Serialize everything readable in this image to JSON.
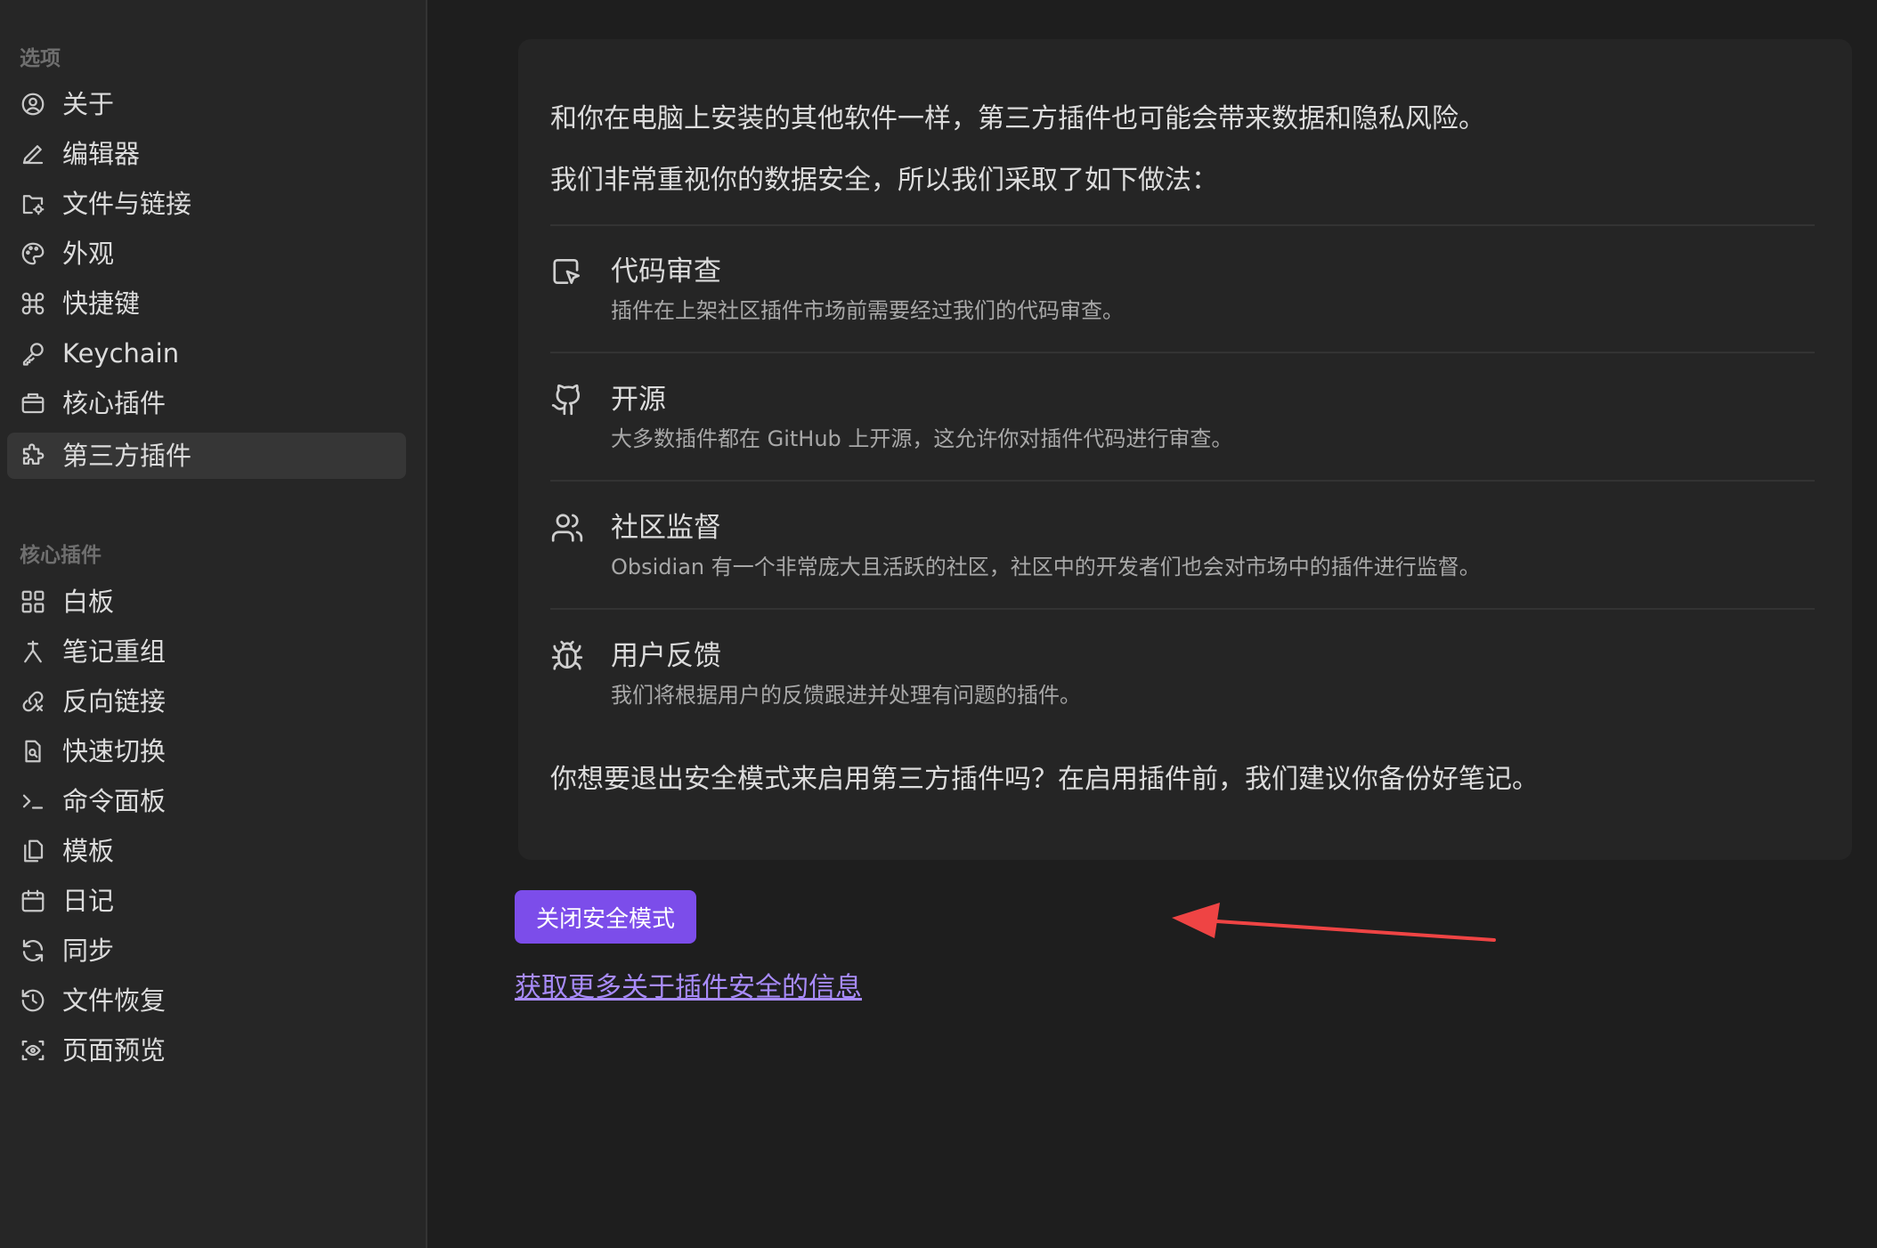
{
  "sidebar": {
    "options_title": "选项",
    "options": [
      {
        "label": "关于",
        "icon": "user-circle-icon"
      },
      {
        "label": "编辑器",
        "icon": "pencil-icon"
      },
      {
        "label": "文件与链接",
        "icon": "folder-cog-icon"
      },
      {
        "label": "外观",
        "icon": "palette-icon"
      },
      {
        "label": "快捷键",
        "icon": "command-icon"
      },
      {
        "label": "Keychain",
        "icon": "key-icon"
      },
      {
        "label": "核心插件",
        "icon": "briefcase-icon"
      },
      {
        "label": "第三方插件",
        "icon": "puzzle-icon",
        "active": true
      }
    ],
    "core_title": "核心插件",
    "core": [
      {
        "label": "白板",
        "icon": "layout-dashboard-icon"
      },
      {
        "label": "笔记重组",
        "icon": "merge-icon"
      },
      {
        "label": "反向链接",
        "icon": "backlink-icon"
      },
      {
        "label": "快速切换",
        "icon": "file-search-icon"
      },
      {
        "label": "命令面板",
        "icon": "terminal-icon"
      },
      {
        "label": "模板",
        "icon": "files-icon"
      },
      {
        "label": "日记",
        "icon": "calendar-icon"
      },
      {
        "label": "同步",
        "icon": "refresh-icon"
      },
      {
        "label": "文件恢复",
        "icon": "history-icon"
      },
      {
        "label": "页面预览",
        "icon": "scan-eye-icon"
      }
    ]
  },
  "main": {
    "intro_1": "和你在电脑上安装的其他软件一样，第三方插件也可能会带来数据和隐私风险。",
    "intro_2": "我们非常重视你的数据安全，所以我们采取了如下做法：",
    "features": [
      {
        "icon": "review-icon",
        "title": "代码审查",
        "desc": "插件在上架社区插件市场前需要经过我们的代码审查。"
      },
      {
        "icon": "github-icon",
        "title": "开源",
        "desc": "大多数插件都在 GitHub 上开源，这允许你对插件代码进行审查。"
      },
      {
        "icon": "users-icon",
        "title": "社区监督",
        "desc": "Obsidian 有一个非常庞大且活跃的社区，社区中的开发者们也会对市场中的插件进行监督。"
      },
      {
        "icon": "bug-icon",
        "title": "用户反馈",
        "desc": "我们将根据用户的反馈跟进并处理有问题的插件。"
      }
    ],
    "question": "你想要退出安全模式来启用第三方插件吗？在启用插件前，我们建议你备份好笔记。",
    "button_label": "关闭安全模式",
    "link_label": "获取更多关于插件安全的信息"
  },
  "colors": {
    "accent": "#7c4dea",
    "link": "#a88bfa",
    "annotation_arrow": "#ef4444"
  }
}
